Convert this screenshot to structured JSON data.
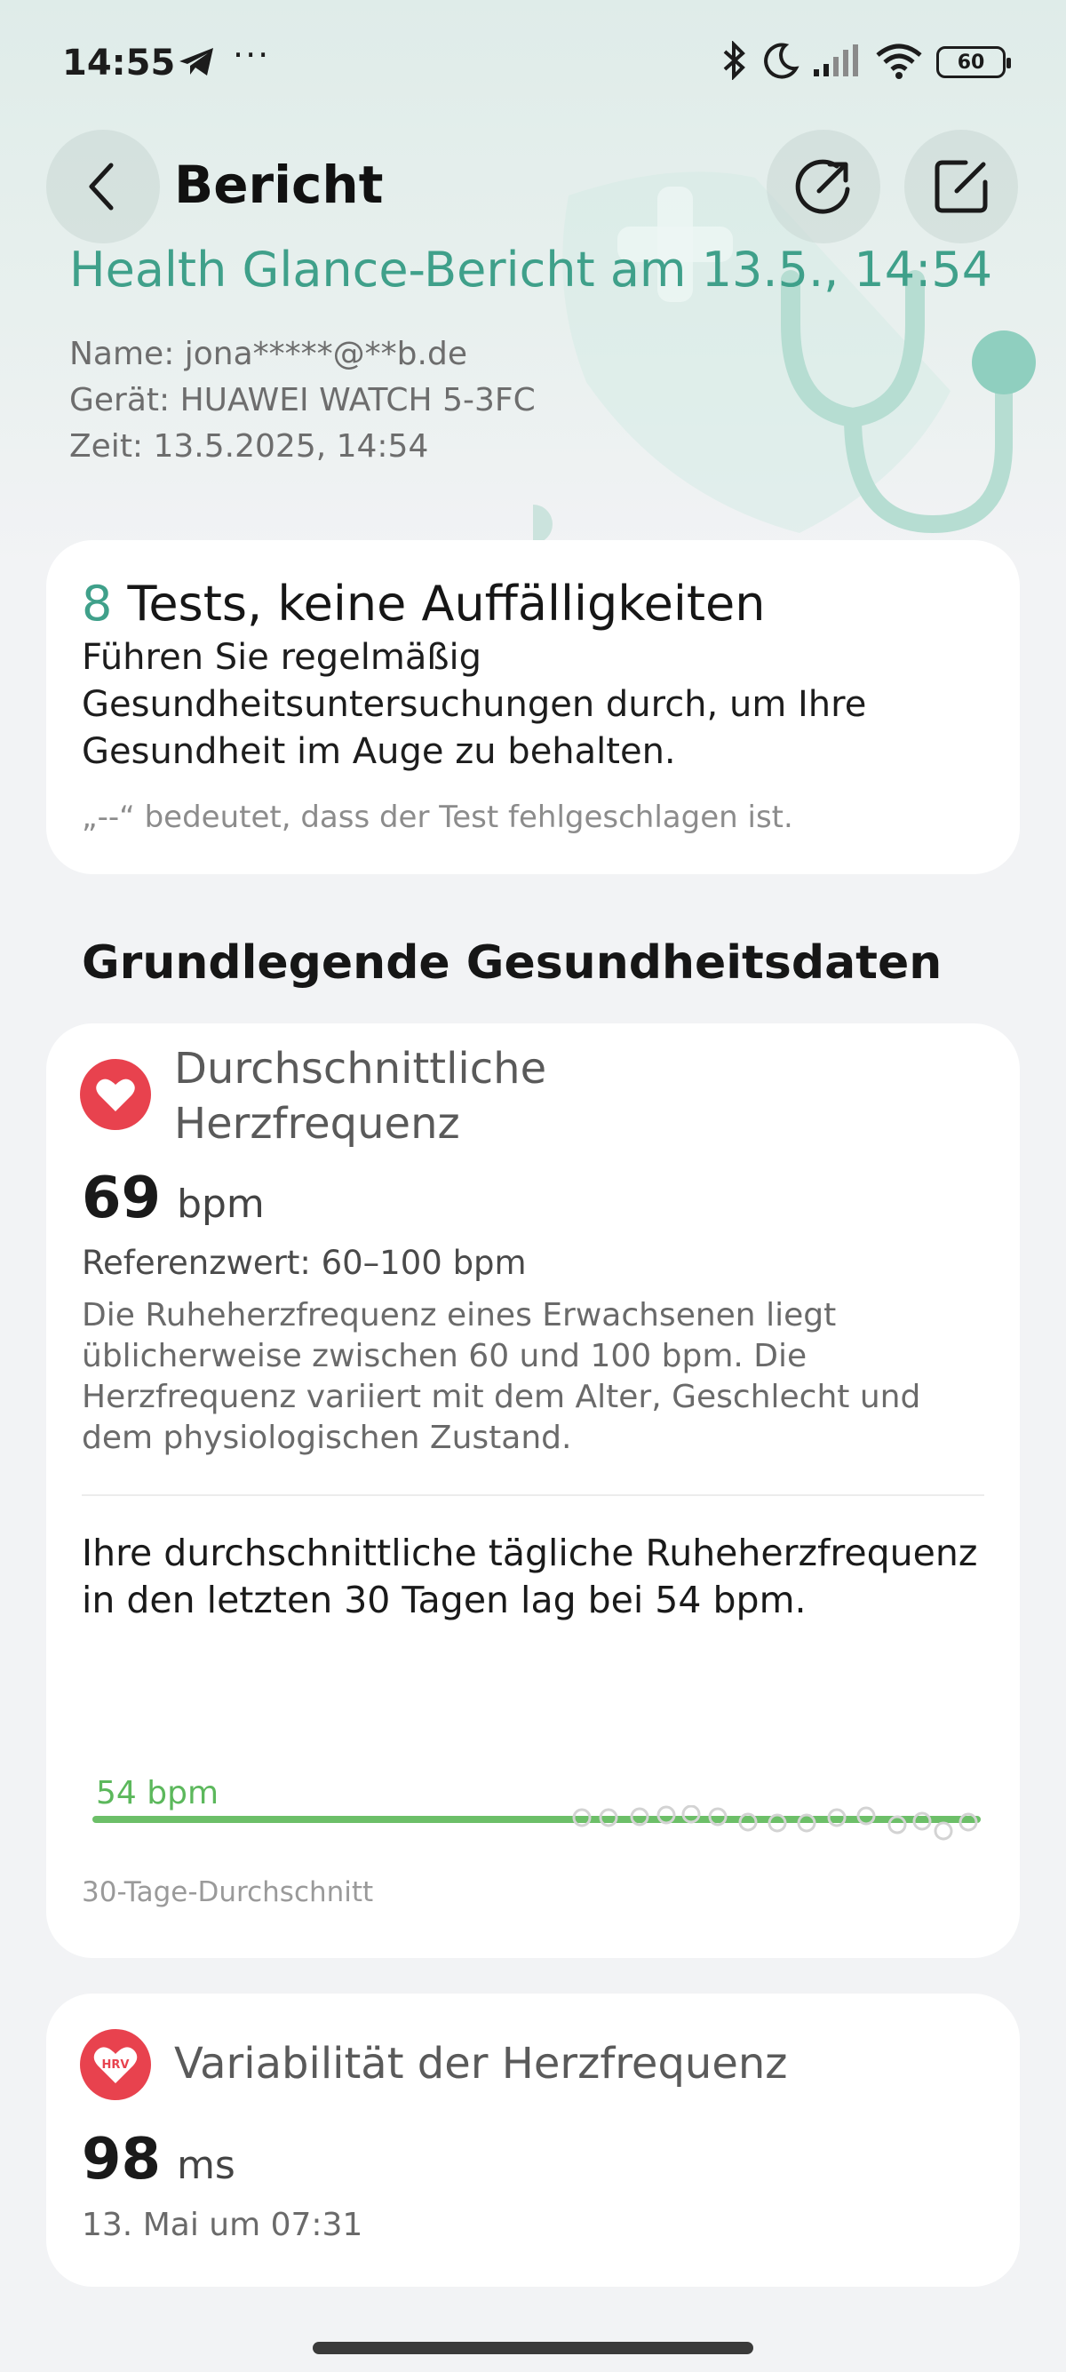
{
  "status_bar": {
    "time": "14:55",
    "dots": "···",
    "battery": "60",
    "icons": [
      "telegram-icon",
      "bluetooth-icon",
      "moon-icon",
      "signal-icon",
      "wifi-icon",
      "battery-icon"
    ]
  },
  "header": {
    "title": "Bericht"
  },
  "report": {
    "heading": "Health Glance-Bericht am 13.5., 14:54",
    "name": "Name: jona*****@**b.de",
    "device": "Gerät: HUAWEI WATCH 5-3FC",
    "time": "Zeit: 13.5.2025, 14:54"
  },
  "summary": {
    "count": "8",
    "title_rest": " Tests, keine Auffälligkeiten",
    "description": "Führen Sie regelmäßig Gesundheitsuntersuchungen durch, um Ihre Gesundheit im Auge zu behalten.",
    "note": "„--“ bedeutet, dass der Test fehlgeschlagen ist."
  },
  "section": {
    "title": "Grundlegende Gesundheitsdaten"
  },
  "heart_rate": {
    "title": "Durchschnittliche Herzfrequenz",
    "value": "69",
    "unit": "bpm",
    "reference": "Referenzwert: 60–100 bpm",
    "description": "Die Ruheherzfrequenz eines Erwachsenen liegt üblicherweise zwischen 60 und 100 bpm. Die Herzfrequenz variiert mit dem Alter, Geschlecht und dem physiologischen Zustand.",
    "trend_text": "Ihre durchschnittliche tägliche Ruheherzfrequenz in den letzten 30 Tagen lag bei 54 bpm.",
    "average_label": "54 bpm",
    "caption": "30-Tage-Durchschnitt"
  },
  "hrv": {
    "title": "Variabilität der Herzfrequenz",
    "icon_text": "HRV",
    "value": "98",
    "unit": "ms",
    "date": "13. Mai um 07:31"
  },
  "colors": {
    "accent": "#3fa08a",
    "heart": "#e8424e",
    "chart_line": "#6cbf68",
    "background": "#f2f3f5"
  }
}
